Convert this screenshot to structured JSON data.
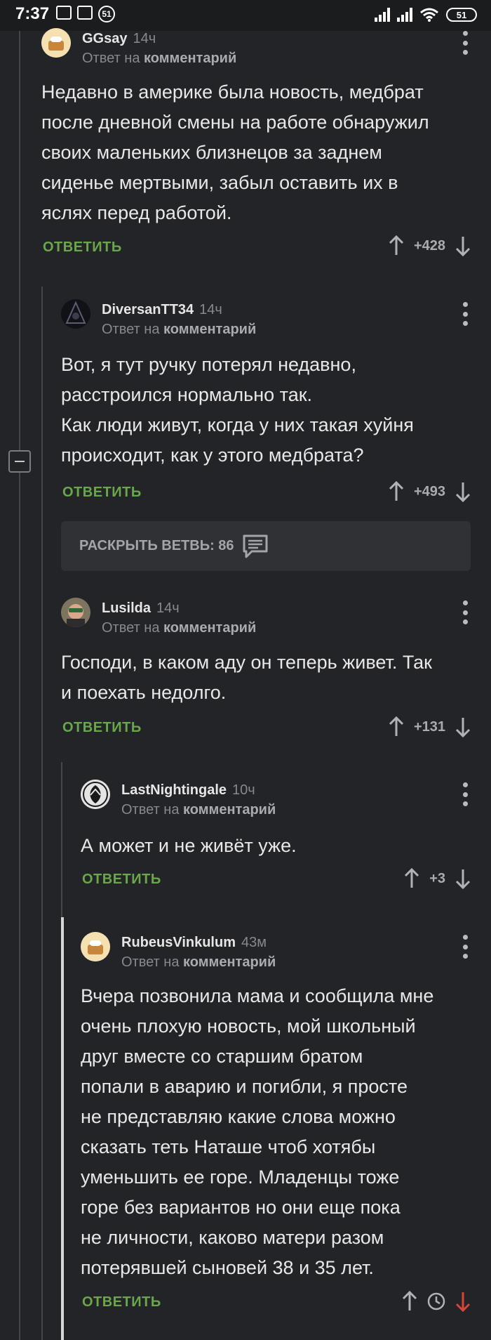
{
  "status_bar": {
    "time": "7:37",
    "notification_count": "51",
    "battery": "51"
  },
  "comments": [
    {
      "author": "GGsay",
      "time": "14ч",
      "reply_prefix": "Ответ на",
      "reply_target": "комментарий",
      "lines": [
        "Недавно в америке была новость, медбрат",
        "после дневной смены на работе обнаружил",
        "своих маленьких близнецов за заднем",
        "сиденье мертвыми, забыл оставить их в",
        "яслях перед работой."
      ],
      "reply_label": "ОТВЕТИТЬ",
      "rating": "+428"
    },
    {
      "author": "DiversanTT34",
      "time": "14ч",
      "reply_prefix": "Ответ на",
      "reply_target": "комментарий",
      "lines": [
        "Вот, я тут ручку потерял недавно,",
        "расстроился нормально так.",
        "Как люди живут, когда у них такая хуйня",
        "происходит, как у этого медбрата?"
      ],
      "reply_label": "ОТВЕТИТЬ",
      "rating": "+493"
    },
    {
      "author": "Lusilda",
      "time": "14ч",
      "reply_prefix": "Ответ на",
      "reply_target": "комментарий",
      "lines": [
        "Господи, в каком аду он теперь живет. Так",
        "и поехать недолго."
      ],
      "reply_label": "ОТВЕТИТЬ",
      "rating": "+131"
    },
    {
      "author": "LastNightingale",
      "time": "10ч",
      "reply_prefix": "Ответ на",
      "reply_target": "комментарий",
      "lines": [
        "А может и не живёт уже."
      ],
      "reply_label": "ОТВЕТИТЬ",
      "rating": "+3"
    },
    {
      "author": "RubeusVinkulum",
      "time": "43м",
      "reply_prefix": "Ответ на",
      "reply_target": "комментарий",
      "lines": [
        "Вчера позвонила мама и сообщила мне",
        "очень плохую новость, мой школьный",
        "друг вместе со старшим братом",
        "попали в аварию и погибли, я просте",
        "не представляю какие слова можно",
        "сказать теть Наташе чтоб хотябы",
        "уменьшить ее горе. Младенцы тоже",
        "горе без вариантов но они еще пока",
        "не личности, каково матери разом",
        "потерявшей сыновей 38 и 35 лет."
      ],
      "reply_label": "ОТВЕТИТЬ"
    }
  ],
  "expand_branch": {
    "label": "РАСКРЫТЬ ВЕТВЬ: 86"
  },
  "colors": {
    "background": "#232427",
    "reply_green": "#6aa64a",
    "downvote_active": "#d8443a",
    "text": "#e8e8e8",
    "muted": "#86898d"
  }
}
